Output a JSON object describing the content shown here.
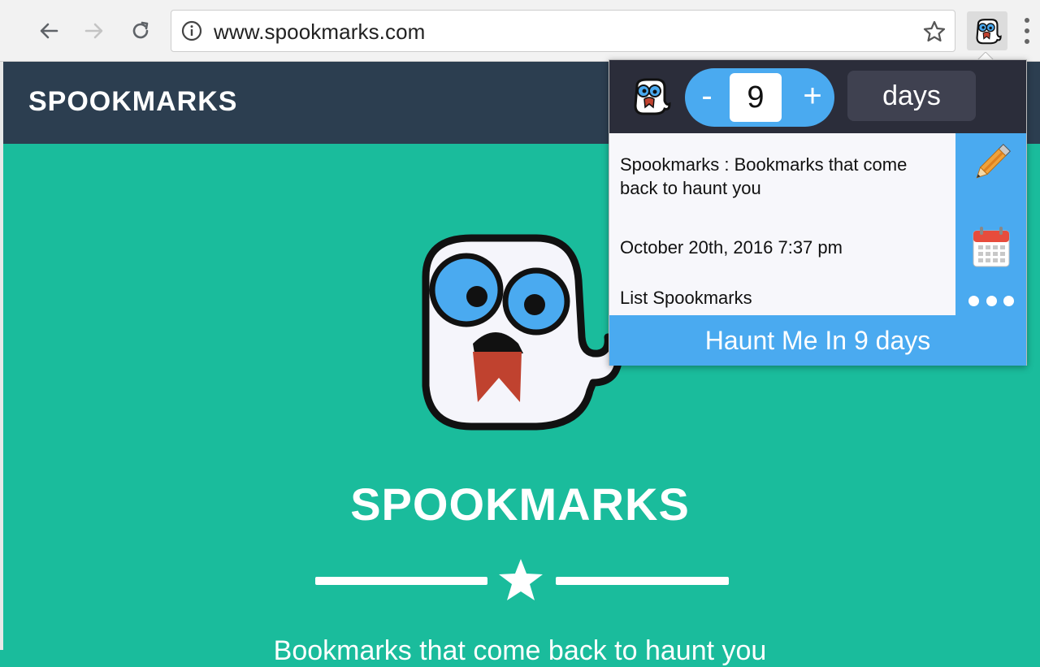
{
  "browser": {
    "url": "www.spookmarks.com",
    "back_icon": "back-arrow-icon",
    "forward_icon": "forward-arrow-icon",
    "reload_icon": "reload-icon"
  },
  "site": {
    "brand": "SPOOKMARKS",
    "hero_title": "SPOOKMARKS",
    "tagline": "Bookmarks that come back to haunt you",
    "colors": {
      "header": "#2c3e50",
      "background": "#1abc9c"
    }
  },
  "popup": {
    "minus": "-",
    "plus": "+",
    "duration_value": "9",
    "duration_unit": "days",
    "bookmark_title": "Spookmarks : Bookmarks that come back to haunt you",
    "bookmark_date": "October 20th, 2016 7:37 pm",
    "list_link": "List Spookmarks",
    "haunt_button": "Haunt Me In 9 days",
    "colors": {
      "accent": "#4aaaf0",
      "top_bar": "#2b2d3a"
    }
  }
}
